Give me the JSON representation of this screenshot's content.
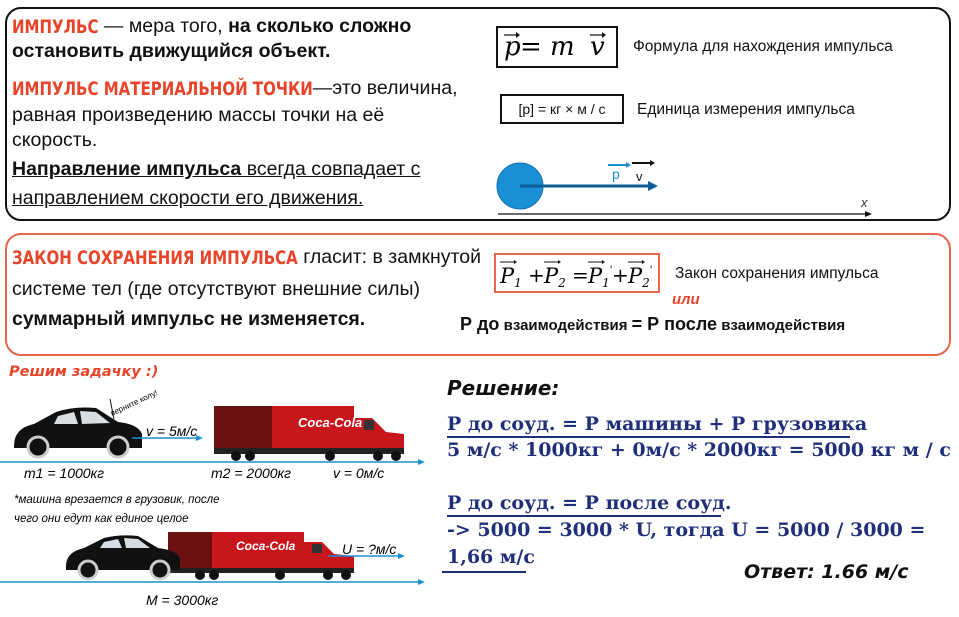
{
  "section1": {
    "def_term": "ИМПУЛЬС",
    "def_rest1": " — мера того, ",
    "def_bold1": "на сколько сложно",
    "def_bold2": "остановить движущийся объект.",
    "mp_term": "ИМПУЛЬС МАТЕРИАЛЬНОЙ ТОЧКИ",
    "mp_rest": "—это величина,",
    "mp_line2": "равная произведению массы точки на её",
    "mp_line3": "скорость.",
    "dir_bold": "Направление импульса",
    "dir_rest": " всегда совпадает с",
    "dir_line2": "направлением скорости его движения.",
    "formula_p": "p",
    "formula_eq": " = m",
    "formula_v": "v",
    "formula_caption": "Формула для нахождения импульса",
    "unit_formula": "[p] = кг × м / с",
    "unit_caption": "Единица измерения импульса",
    "diagram_p": "p",
    "diagram_v": "v",
    "diagram_x": "x"
  },
  "section2": {
    "law_term": "ЗАКОН СОХРАНЕНИЯ ИМПУЛЬСА",
    "law_rest": " гласит: в замкнутой",
    "law_line2": "системе тел (где отсутствуют внешние силы)",
    "law_line3": "суммарный импульс не изменяется.",
    "law_formula": "P1 + P2 = P1' + P2'",
    "law_caption": "Закон сохранения импульса",
    "or": "или",
    "alt_p1": "Р до",
    "alt_w1": " взаимодействия ",
    "alt_eq": "= Р после",
    "alt_w2": " взаимодействия"
  },
  "problem": {
    "heading": "Решим задачку :)",
    "turn_note": "верните колу!",
    "car_speed": "v = 5м/с",
    "car_mass": "m1 = 1000кг",
    "truck_mass": "m2 = 2000кг",
    "truck_speed": "v = 0м/с",
    "note_line1": "*машина врезается в грузовик, после",
    "note_line2": "чего они едут как единое целое",
    "combined_speed": "U = ?м/с",
    "combined_mass": "M = 3000кг",
    "brand": "Coca-Cola"
  },
  "solution": {
    "heading": "Решение:",
    "line1": "Р до соуд. = Р машины + Р грузовика",
    "line2": "5 м/с * 1000кг + 0м/с * 2000кг = 5000 кг м / с",
    "line3": "Р до соуд. = Р после соуд.",
    "line4": "-> 5000 = 3000 * U, тогда U = 5000 / 3000 =",
    "line5": "1,66 м/с",
    "answer": "Ответ: 1.66 м/с"
  },
  "colors": {
    "accent_red": "#e8442a",
    "box2_border": "#e8644a",
    "blue": "#1a8fd6",
    "navy": "#1f2f7a"
  }
}
